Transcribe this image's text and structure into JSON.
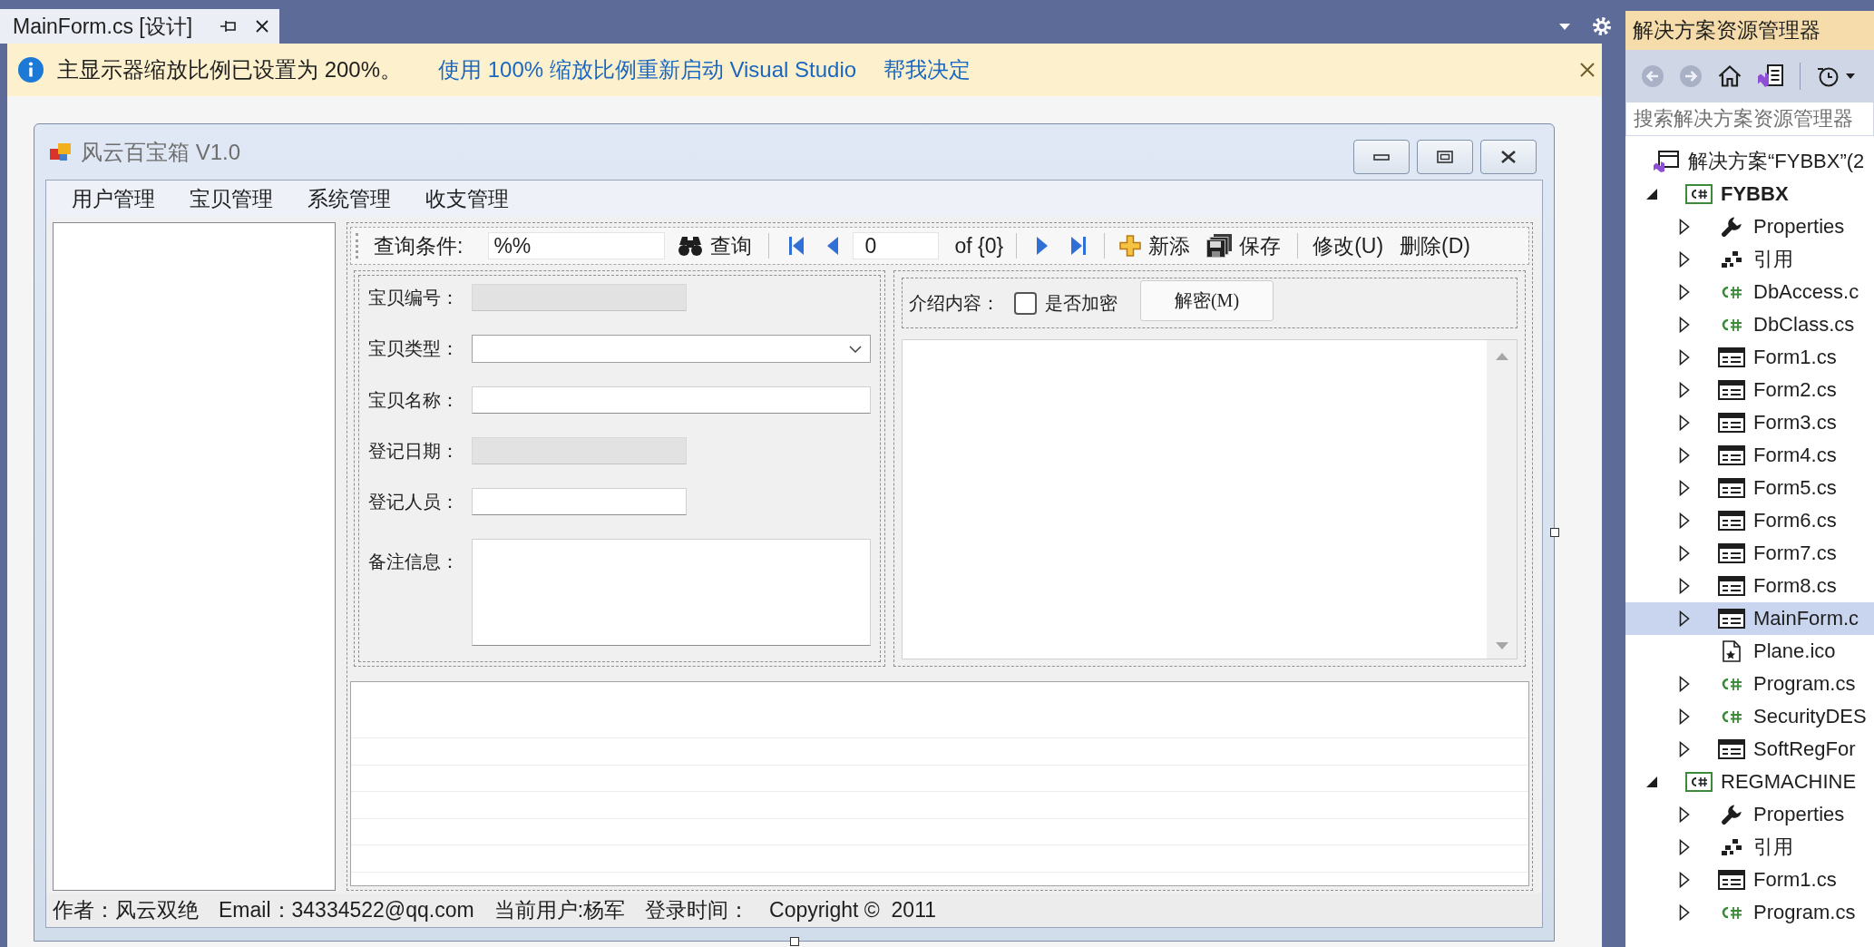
{
  "document_tabs": [
    {
      "title": "MainForm.cs [设计]",
      "selected": true
    }
  ],
  "info_bar": {
    "message": "主显示器缩放比例已设置为 200%。",
    "links": [
      "使用 100% 缩放比例重新启动 Visual Studio",
      "帮我决定"
    ]
  },
  "form_window": {
    "title": "风云百宝箱 V1.0",
    "menu": [
      "用户管理",
      "宝贝管理",
      "系统管理",
      "收支管理"
    ],
    "toolbar": [
      {
        "kind": "label",
        "text": "查询条件:"
      },
      {
        "kind": "field",
        "value": "%%"
      },
      {
        "kind": "query",
        "text": "查询"
      },
      {
        "kind": "separator"
      },
      {
        "kind": "first"
      },
      {
        "kind": "previous"
      },
      {
        "kind": "position",
        "value": "0"
      },
      {
        "kind": "label",
        "text": "of {0}"
      },
      {
        "kind": "separator"
      },
      {
        "kind": "next"
      },
      {
        "kind": "last"
      },
      {
        "kind": "separator"
      },
      {
        "kind": "add",
        "text": "新添"
      },
      {
        "kind": "save",
        "text": "保存"
      },
      {
        "kind": "separator"
      },
      {
        "kind": "plain",
        "text": "修改(U)"
      },
      {
        "kind": "plain",
        "text": "删除(D)"
      }
    ],
    "item_panel": {
      "fields": [
        {
          "label": "宝贝编号：",
          "kind": "short",
          "disabled": true
        },
        {
          "label": "宝贝类型：",
          "kind": "combo",
          "disabled": false
        },
        {
          "label": "宝贝名称：",
          "kind": "long",
          "disabled": false
        },
        {
          "label": "登记日期：",
          "kind": "short",
          "disabled": true
        },
        {
          "label": "登记人员：",
          "kind": "short",
          "disabled": false
        },
        {
          "label": "备注信息：",
          "kind": "memo",
          "disabled": false
        }
      ]
    },
    "intro_panel": {
      "label": "介绍内容：",
      "encrypt": {
        "label": "是否加密",
        "checked": false
      },
      "decrypt_button": "解密(M)"
    },
    "status_bar": [
      "作者：风云双绝",
      "Email：34334522@qq.com",
      "当前用户:杨军",
      "登录时间：",
      "Copyright ©  2011"
    ]
  },
  "solution_explorer": {
    "title": "解决方案资源管理器",
    "search": {
      "placeholder": "搜索解决方案资源管理器"
    },
    "tree": [
      {
        "label": "解决方案“FYBBX”(2",
        "kind": "solution",
        "selected": false,
        "children": [
          {
            "label": "FYBBX",
            "kind": "project",
            "startup": true,
            "expanded": true,
            "selected": false,
            "children": [
              {
                "label": "Properties",
                "kind": "properties",
                "expanded": false,
                "selected": false
              },
              {
                "label": "引用",
                "kind": "references",
                "expanded": false,
                "selected": false
              },
              {
                "label": "DbAccess.c",
                "kind": "code",
                "expanded": false,
                "selected": false
              },
              {
                "label": "DbClass.cs",
                "kind": "code",
                "expanded": false,
                "selected": false
              },
              {
                "label": "Form1.cs",
                "kind": "form",
                "expanded": false,
                "selected": false
              },
              {
                "label": "Form2.cs",
                "kind": "form",
                "expanded": false,
                "selected": false
              },
              {
                "label": "Form3.cs",
                "kind": "form",
                "expanded": false,
                "selected": false
              },
              {
                "label": "Form4.cs",
                "kind": "form",
                "expanded": false,
                "selected": false
              },
              {
                "label": "Form5.cs",
                "kind": "form",
                "expanded": false,
                "selected": false
              },
              {
                "label": "Form6.cs",
                "kind": "form",
                "expanded": false,
                "selected": false
              },
              {
                "label": "Form7.cs",
                "kind": "form",
                "expanded": false,
                "selected": false
              },
              {
                "label": "Form8.cs",
                "kind": "form",
                "expanded": false,
                "selected": false
              },
              {
                "label": "MainForm.c",
                "kind": "form",
                "expanded": false,
                "selected": true
              },
              {
                "label": "Plane.ico",
                "kind": "image",
                "selected": false
              },
              {
                "label": "Program.cs",
                "kind": "code",
                "expanded": false,
                "selected": false
              },
              {
                "label": "SecurityDES",
                "kind": "code",
                "expanded": false,
                "selected": false
              },
              {
                "label": "SoftRegFor",
                "kind": "form",
                "expanded": false,
                "selected": false
              }
            ]
          },
          {
            "label": "REGMACHINE",
            "kind": "project",
            "startup": false,
            "expanded": true,
            "selected": false,
            "children": [
              {
                "label": "Properties",
                "kind": "properties",
                "expanded": false,
                "selected": false
              },
              {
                "label": "引用",
                "kind": "references",
                "expanded": false,
                "selected": false
              },
              {
                "label": "Form1.cs",
                "kind": "form",
                "expanded": false,
                "selected": false
              },
              {
                "label": "Program.cs",
                "kind": "code",
                "expanded": false,
                "selected": false
              }
            ]
          }
        ]
      }
    ]
  }
}
